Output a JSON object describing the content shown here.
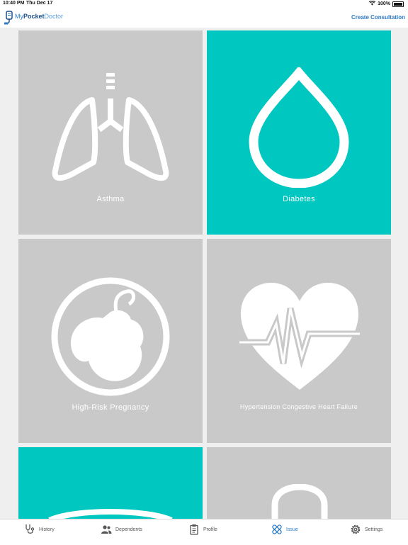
{
  "status_bar": {
    "time": "10:40 PM",
    "date": "Thu Dec 17",
    "battery": "100%"
  },
  "header": {
    "logo_parts": [
      "My",
      "Pocket",
      "Doctor"
    ],
    "create_consultation": "Create Consultation"
  },
  "tiles": [
    {
      "label": "Asthma",
      "icon": "lungs-icon",
      "active": false
    },
    {
      "label": "Diabetes",
      "icon": "drop-icon",
      "active": true
    },
    {
      "label": "High-Risk Pregnancy",
      "icon": "fetus-icon",
      "active": false
    },
    {
      "label": "Hypertension Congestive Heart Failure",
      "icon": "heartbeat-icon",
      "active": false
    }
  ],
  "tabs": [
    {
      "label": "History",
      "icon": "stethoscope-icon",
      "active": false
    },
    {
      "label": "Dependents",
      "icon": "people-icon",
      "active": false
    },
    {
      "label": "Profile",
      "icon": "clipboard-icon",
      "active": false
    },
    {
      "label": "Issue",
      "icon": "bandage-icon",
      "active": true
    },
    {
      "label": "Settings",
      "icon": "gear-icon",
      "active": false
    }
  ],
  "colors": {
    "accent": "#00c7c0",
    "tile_gray": "#c9c9c9",
    "link_blue": "#2c78c4"
  }
}
